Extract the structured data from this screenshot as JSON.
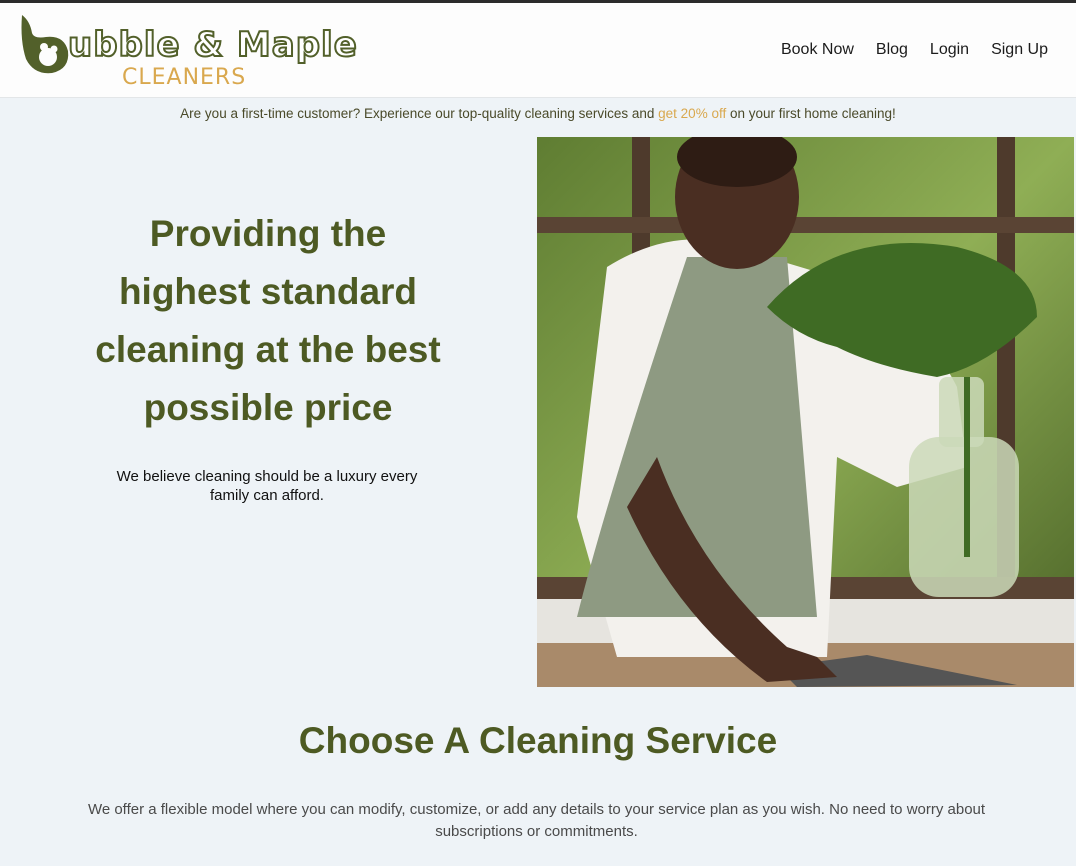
{
  "brand": {
    "name": "ubble & Maple",
    "subtitle": "CLEANERS",
    "colors": {
      "primary": "#4d5a23",
      "accent": "#d9a84e"
    }
  },
  "nav": {
    "items": [
      {
        "label": "Book Now"
      },
      {
        "label": "Blog"
      },
      {
        "label": "Login"
      },
      {
        "label": "Sign Up"
      }
    ]
  },
  "promo": {
    "text_before": "Are you a first-time customer? Experience our top-quality cleaning services and ",
    "highlight": "get 20% off",
    "text_after": " on your first home cleaning!"
  },
  "hero": {
    "title": "Providing the highest standard cleaning at the best possible price",
    "subtitle": "We believe cleaning should be a luxury every family can afford.",
    "image_icon": "photo-cleaner-with-plant"
  },
  "services": {
    "title": "Choose A Cleaning Service",
    "description": "We offer a flexible model where you can modify, customize, or add any details to your service plan as you wish. No need to worry about subscriptions or commitments."
  }
}
